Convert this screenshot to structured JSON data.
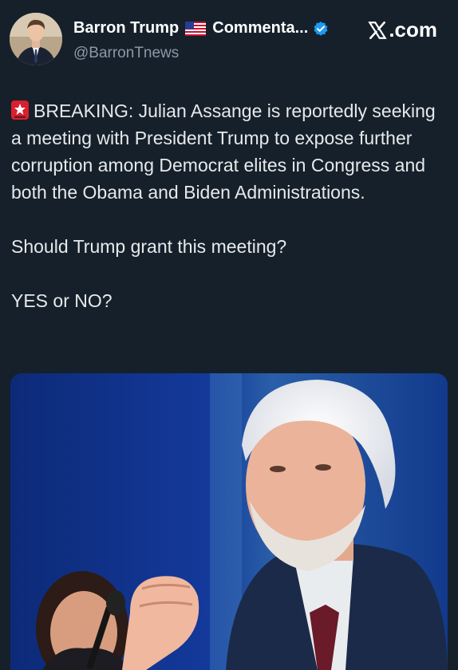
{
  "author": {
    "display_name": "Barron Trump",
    "flag_icon": "us-flag-icon",
    "display_name_suffix": "Commenta...",
    "verified_icon": "verified-badge-icon",
    "verified_color": "#1d9bf0",
    "handle": "@BarronTnews",
    "avatar_icon": "user-avatar"
  },
  "source": {
    "logo_icon": "x-logo-icon",
    "label": ".com"
  },
  "tweet": {
    "emoji_icon": "siren-icon",
    "paragraph_1": "BREAKING: Julian Assange is reportedly seeking a meeting with President Trump to expose further corruption among Democrat elites in Congress and both the Obama and Biden Administrations.",
    "paragraph_2": "Should Trump grant this meeting?",
    "paragraph_3": "YES or NO?"
  },
  "media": {
    "type": "photo"
  },
  "colors": {
    "background": "#15202b",
    "text": "#e7e9ea",
    "secondary_text": "#8b98a5"
  }
}
